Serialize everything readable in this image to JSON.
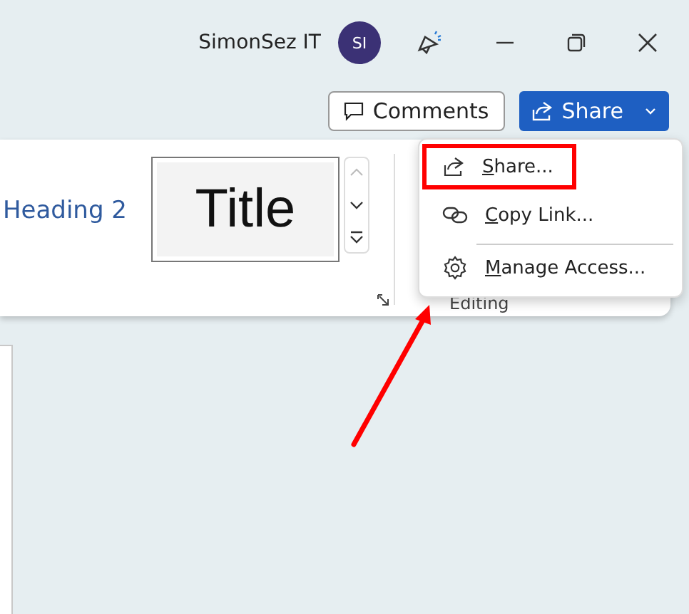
{
  "title_bar": {
    "user_name": "SimonSez IT",
    "avatar_initials": "SI"
  },
  "actions": {
    "comments_label": "Comments",
    "share_label": "Share"
  },
  "ribbon": {
    "styles": [
      {
        "label": "Heading 2",
        "kind": "heading"
      },
      {
        "label": "Title",
        "kind": "title"
      }
    ],
    "group_label": "Editing"
  },
  "share_menu": [
    {
      "label": "Share...",
      "kind": "share",
      "highlighted": true,
      "divider_after": false
    },
    {
      "label": "Copy Link...",
      "kind": "link",
      "highlighted": false,
      "divider_after": true
    },
    {
      "label": "Manage Access...",
      "kind": "access",
      "highlighted": false,
      "divider_after": false
    }
  ]
}
